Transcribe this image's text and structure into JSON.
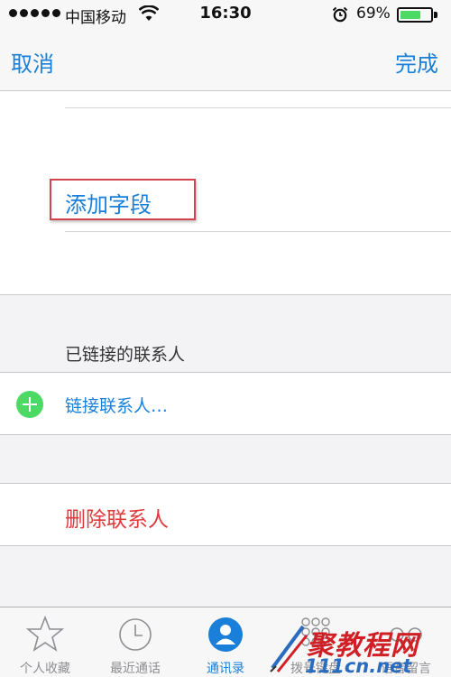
{
  "status_bar": {
    "carrier": "中国移动",
    "time": "16:30",
    "battery_percent": "69%",
    "battery_level": 0.69,
    "signal_bars": 5
  },
  "nav": {
    "cancel_label": "取消",
    "done_label": "完成"
  },
  "form": {
    "add_field_label": "添加字段",
    "linked_header": "已链接的联系人",
    "link_contact_label": "链接联系人…",
    "delete_contact_label": "删除联系人"
  },
  "tabs": [
    {
      "label": "个人收藏",
      "icon": "star-icon",
      "active": false
    },
    {
      "label": "最近通话",
      "icon": "clock-icon",
      "active": false
    },
    {
      "label": "通讯录",
      "icon": "contacts-icon",
      "active": true
    },
    {
      "label": "拨号键盘",
      "icon": "keypad-icon",
      "active": false
    },
    {
      "label": "语音留言",
      "icon": "voicemail-icon",
      "active": false
    }
  ],
  "watermark": {
    "text": "聚教程网",
    "url": "111cn.net"
  },
  "colors": {
    "accent": "#1a7fd9",
    "destructive": "#e0383b",
    "add_green": "#4cd964",
    "highlight_box": "#d2444b"
  }
}
